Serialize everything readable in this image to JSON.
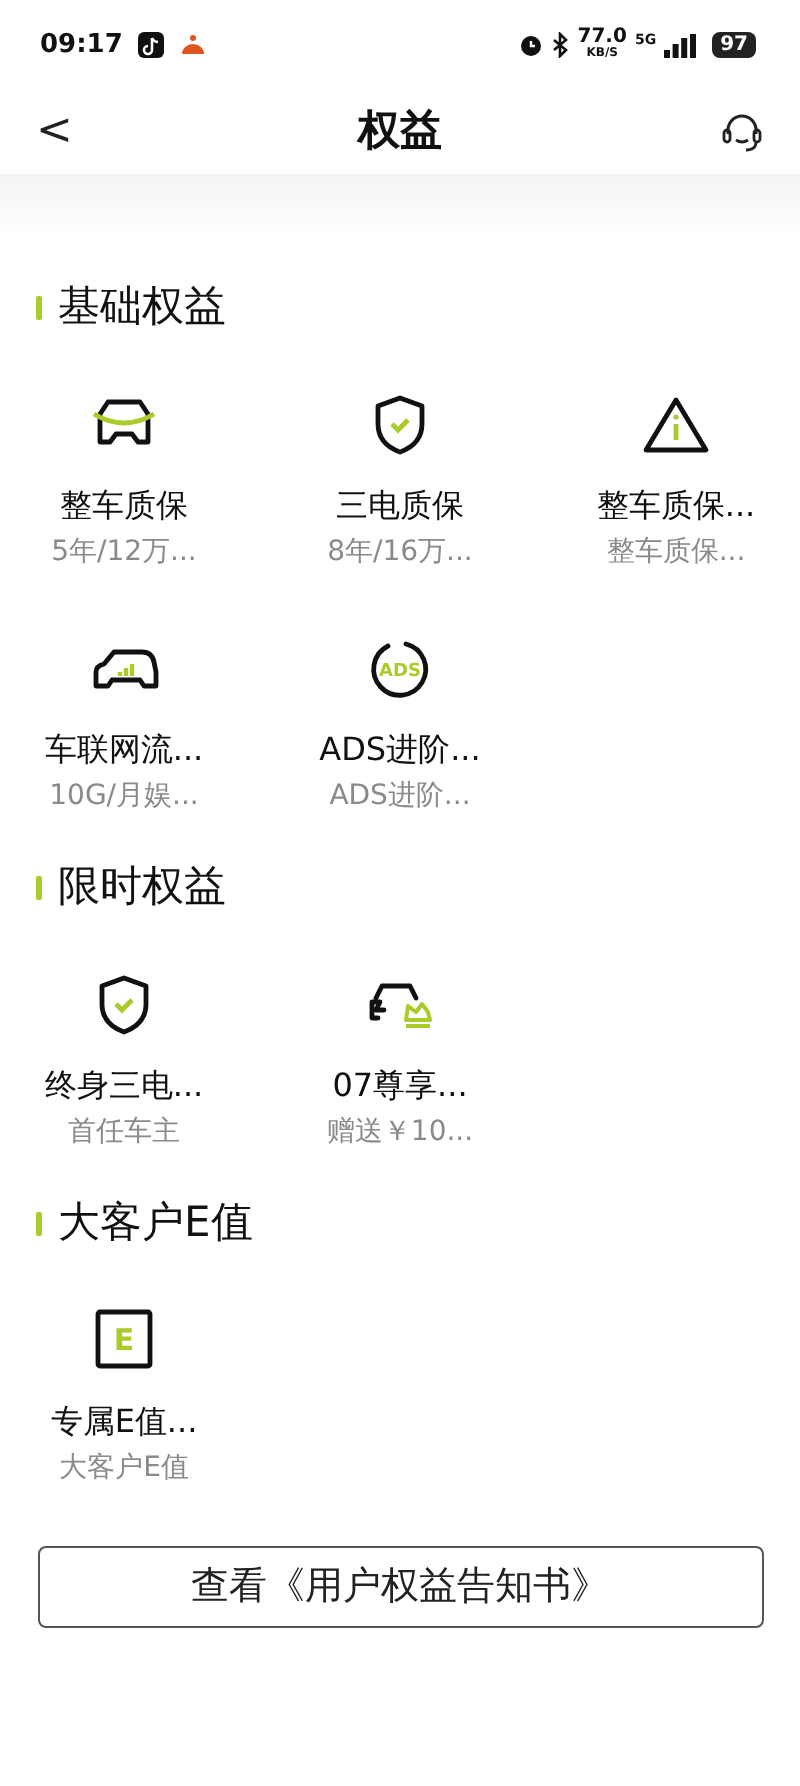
{
  "status_bar": {
    "time": "09:17",
    "speed": "77.0",
    "speed_unit": "KB/S",
    "network": "5G",
    "battery": "97"
  },
  "header": {
    "back": "<",
    "title": "权益"
  },
  "sections": [
    {
      "title": "基础权益",
      "items": [
        {
          "title": "整车质保",
          "subtitle": "5年/12万..."
        },
        {
          "title": "三电质保",
          "subtitle": "8年/16万..."
        },
        {
          "title": "整车质保...",
          "subtitle": "整车质保..."
        },
        {
          "title": "车联网流...",
          "subtitle": "10G/月娱..."
        },
        {
          "title": "ADS进阶...",
          "subtitle": "ADS进阶...",
          "icon_text": "ADS"
        }
      ]
    },
    {
      "title": "限时权益",
      "items": [
        {
          "title": "终身三电...",
          "subtitle": "首任车主"
        },
        {
          "title": "07尊享...",
          "subtitle": "赠送￥10..."
        }
      ]
    },
    {
      "title": "大客户E值",
      "items": [
        {
          "title": "专属E值...",
          "subtitle": "大客户E值",
          "icon_text": "E"
        }
      ]
    }
  ],
  "notice_button": "查看《用户权益告知书》"
}
